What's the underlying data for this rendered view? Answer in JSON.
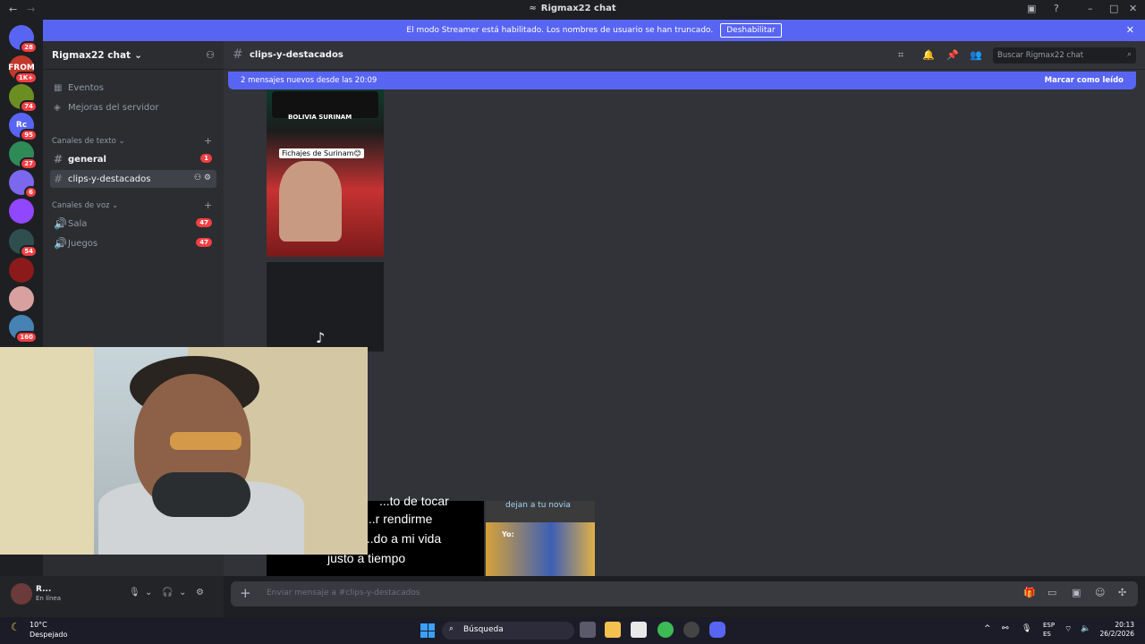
{
  "window": {
    "title": "Rigmax22 chat",
    "back": "←",
    "forward": "→"
  },
  "banner": {
    "text": "El modo Streamer está habilitado. Los nombres de usuario se han truncado.",
    "button": "Deshabilitar",
    "close": "✕"
  },
  "guilds": [
    {
      "label": "",
      "badge": "28",
      "color": "#5865f2"
    },
    {
      "label": "FROM",
      "badge": "1K+",
      "color": "#c0392b"
    },
    {
      "label": "",
      "badge": "74",
      "color": "#6b8e23"
    },
    {
      "label": "Rc",
      "badge": "95",
      "color": "#5865f2"
    },
    {
      "label": "",
      "badge": "27",
      "color": "#2e8b57"
    },
    {
      "label": "",
      "badge": "6",
      "color": "#7b68ee"
    },
    {
      "label": "",
      "badge": "",
      "color": "#9146ff"
    },
    {
      "label": "",
      "badge": "54",
      "color": "#2f4f4f"
    },
    {
      "label": "",
      "badge": "",
      "color": "#8b1a1a"
    },
    {
      "label": "",
      "badge": "",
      "color": "#d9a0a0"
    },
    {
      "label": "",
      "badge": "160",
      "color": "#4682b4"
    }
  ],
  "server": {
    "name": "Rigmax22 chat",
    "chevron": "⌄",
    "items": [
      {
        "label": "Eventos",
        "icon": "📅"
      },
      {
        "label": "Mejoras del servidor",
        "icon": "◈"
      }
    ],
    "text_category": "Canales de texto",
    "voice_category": "Canales de voz",
    "text_channels": [
      {
        "name": "general",
        "badge": "1"
      },
      {
        "name": "clips-y-destacados",
        "badge": ""
      }
    ],
    "voice_channels": [
      {
        "name": "Sala",
        "badge": "47"
      },
      {
        "name": "Juegos",
        "badge": "47"
      }
    ]
  },
  "user": {
    "name": "R...",
    "status": "En línea"
  },
  "channel": {
    "name": "clips-y-destacados",
    "search_placeholder": "Buscar Rigmax22 chat"
  },
  "new_messages": {
    "text": "2 mensajes nuevos desde las 20:09",
    "action": "Marcar como leído"
  },
  "video1": {
    "teams": "BOLIVIA SURINAM",
    "caption": "Fichajes de Surinam😊"
  },
  "bottom_clip": {
    "lines": [
      "...to de tocar",
      "...r rendirme",
      "...do a mi vida",
      "justo a tiempo"
    ]
  },
  "meme": {
    "title": "dejan a tu novia",
    "label": "Yo:"
  },
  "composer": {
    "placeholder": "Enviar mensaje a #clips-y-destacados"
  },
  "taskbar": {
    "temp": "10°C",
    "condition": "Despejado",
    "search": "Búsqueda",
    "lang1": "ESP",
    "lang2": "ES",
    "time": "20:13",
    "date": "26/2/2026"
  }
}
